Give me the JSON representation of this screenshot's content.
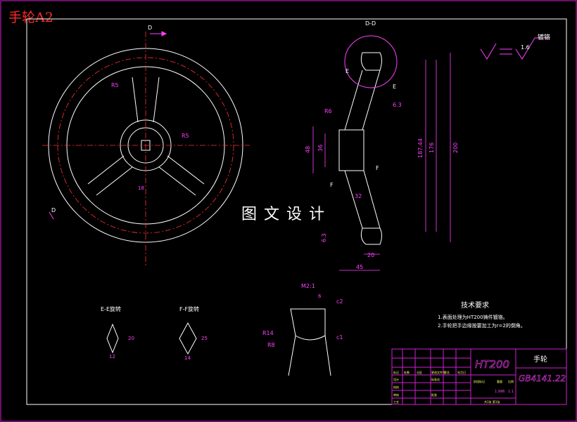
{
  "drawing": {
    "corner_tag": "手轮A2",
    "watermark": "图文设计",
    "section_dd": "D-D",
    "arrow_d": "D",
    "label_e": "E",
    "label_f": "F",
    "finish": "1.6",
    "finish_note": "镀铬",
    "finish_mid": "6.3",
    "dims_main": {
      "r5_top": "R5",
      "r5_hub": "R5",
      "r6": "R6",
      "d48": "48",
      "d36": "36",
      "d18744": "187.44",
      "d176": "176",
      "d200": "200",
      "d20": "20",
      "d45": "45",
      "d32": "32",
      "d63": "6.3",
      "keyway": "18"
    },
    "detail_scale": "M2:1",
    "detail_dims": {
      "d6": "6",
      "c2": "c2",
      "r14": "R14",
      "r8": "R8",
      "c1": "c1"
    },
    "section_ee": {
      "title": "E-E旋转",
      "d20": "20",
      "d12": "12"
    },
    "section_ff": {
      "title": "F-F旋转",
      "d25": "25",
      "d14": "14"
    },
    "tech_req": {
      "title": "技术要求",
      "items": [
        "1.表面处理为HT200铸件镀铬。",
        "2.手轮把手边缘按要加工为r=2的倒角。"
      ]
    },
    "title_block": {
      "material": "HT200",
      "part_name": "手轮",
      "standard": "GB4141.22",
      "hdr_cells": [
        "标记",
        "处数",
        "分区",
        "更改文件号",
        "签名",
        "年月日"
      ],
      "row_labels": [
        "设计",
        "校核",
        "审核",
        "工艺"
      ],
      "std_label": "标准化",
      "approve": "批准",
      "stage_label": "阶段标记",
      "weight_label": "重量",
      "scale_label": "比例",
      "weight_value": "1.996",
      "scale_value": "1:1",
      "sheet_info": "共1张  第1张"
    }
  }
}
